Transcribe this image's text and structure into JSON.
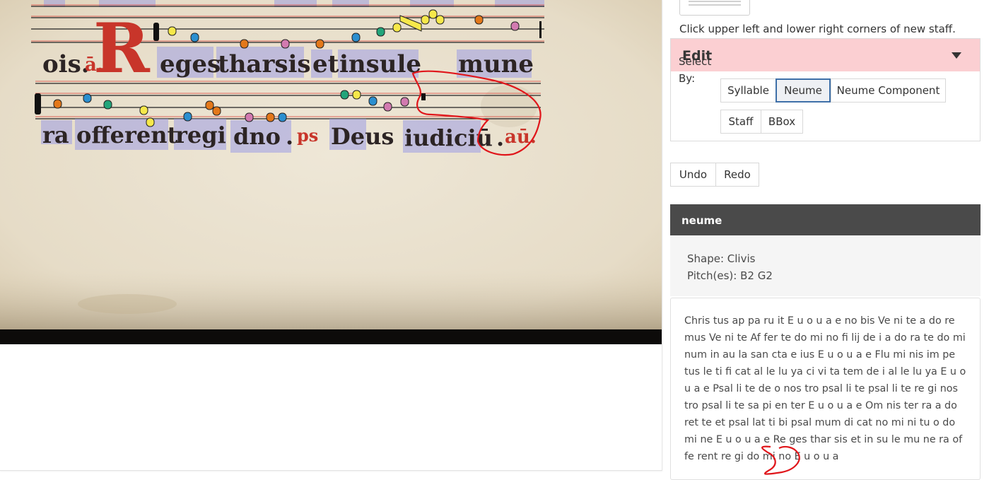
{
  "viewer": {
    "lyrics_row1": [
      "ois.",
      "ā.",
      "R",
      "eges",
      "tharsis",
      "et",
      "insule",
      "mune"
    ],
    "lyrics_row2": [
      "ra",
      "offerent",
      "regi",
      "dno",
      ".",
      "ps",
      "Deus",
      "iudiciū",
      ".",
      "aū."
    ]
  },
  "panel": {
    "staff_hint": "Click upper left and lower right corners of new staff.",
    "edit": {
      "title": "Edit",
      "select_by_label": "Select By:",
      "buttons": [
        "Syllable",
        "Neume",
        "Neume Component",
        "Staff",
        "BBox"
      ],
      "active": "Neume"
    },
    "undo_label": "Undo",
    "redo_label": "Redo",
    "info": {
      "header": "neume",
      "shape": "Shape: Clivis",
      "pitches": "Pitch(es): B2 G2"
    },
    "text": "Chris tus ap pa ru it E u o u a e no bis Ve ni te a do re mus Ve ni te Af fer te do mi no fi lij de i a do ra te do mi num in au la san cta e ius E u o u a e Flu mi nis im pe tus le ti fi cat al le lu ya ci vi ta tem de i al le lu ya E u o u a e Psal li te de o nos tro psal li te psal li te re gi nos tro psal li te sa pi en ter E u o u a e Om nis ter ra a do ret te et psal lat ti bi psal mum di cat no mi ni tu o do mi ne E u o u a e Re ges thar sis et in su le mu ne ra of fe rent re gi do mi no E u o u a"
  },
  "colors": {
    "selected_header": "#fbcfd2",
    "info_header": "#4a4a4a",
    "active_border": "#3e6fa8",
    "neume_yellow": "#f6e84a",
    "neume_blue": "#2b8fd0",
    "neume_orange": "#e3781a",
    "neume_pink": "#d27ab0",
    "neume_green": "#22a57a",
    "annotation_red": "#e0161b"
  }
}
